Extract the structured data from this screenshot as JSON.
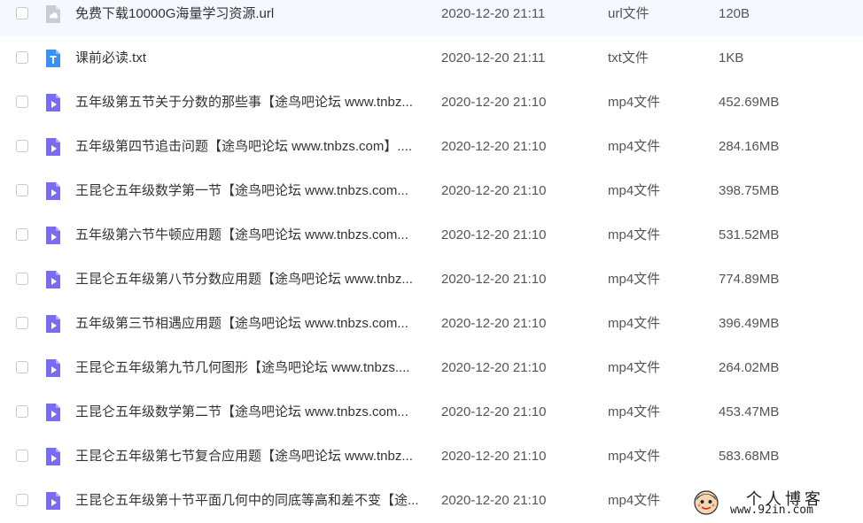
{
  "files": [
    {
      "icon": "link-file-icon",
      "name": "免费下载10000G海量学习资源.url",
      "date": "2020-12-20 21:11",
      "type": "url文件",
      "size": "120B"
    },
    {
      "icon": "text-file-icon",
      "name": "课前必读.txt",
      "date": "2020-12-20 21:11",
      "type": "txt文件",
      "size": "1KB"
    },
    {
      "icon": "video-file-icon",
      "name": "五年级第五节关于分数的那些事【途鸟吧论坛 www.tnbz...",
      "date": "2020-12-20 21:10",
      "type": "mp4文件",
      "size": "452.69MB"
    },
    {
      "icon": "video-file-icon",
      "name": "五年级第四节追击问题【途鸟吧论坛 www.tnbzs.com】....",
      "date": "2020-12-20 21:10",
      "type": "mp4文件",
      "size": "284.16MB"
    },
    {
      "icon": "video-file-icon",
      "name": "王昆仑五年级数学第一节【途鸟吧论坛 www.tnbzs.com...",
      "date": "2020-12-20 21:10",
      "type": "mp4文件",
      "size": "398.75MB"
    },
    {
      "icon": "video-file-icon",
      "name": "五年级第六节牛顿应用题【途鸟吧论坛 www.tnbzs.com...",
      "date": "2020-12-20 21:10",
      "type": "mp4文件",
      "size": "531.52MB"
    },
    {
      "icon": "video-file-icon",
      "name": "王昆仑五年级第八节分数应用题【途鸟吧论坛 www.tnbz...",
      "date": "2020-12-20 21:10",
      "type": "mp4文件",
      "size": "774.89MB"
    },
    {
      "icon": "video-file-icon",
      "name": "五年级第三节相遇应用题【途鸟吧论坛 www.tnbzs.com...",
      "date": "2020-12-20 21:10",
      "type": "mp4文件",
      "size": "396.49MB"
    },
    {
      "icon": "video-file-icon",
      "name": "王昆仑五年级第九节几何图形【途鸟吧论坛 www.tnbzs....",
      "date": "2020-12-20 21:10",
      "type": "mp4文件",
      "size": "264.02MB"
    },
    {
      "icon": "video-file-icon",
      "name": "王昆仑五年级数学第二节【途鸟吧论坛 www.tnbzs.com...",
      "date": "2020-12-20 21:10",
      "type": "mp4文件",
      "size": "453.47MB"
    },
    {
      "icon": "video-file-icon",
      "name": "王昆仑五年级第七节复合应用题【途鸟吧论坛 www.tnbz...",
      "date": "2020-12-20 21:10",
      "type": "mp4文件",
      "size": "583.68MB"
    },
    {
      "icon": "video-file-icon",
      "name": "王昆仑五年级第十节平面几何中的同底等高和差不变【途...",
      "date": "2020-12-20 21:10",
      "type": "mp4文件",
      "size": ""
    }
  ],
  "colors": {
    "video_icon": "#7a6cf0",
    "text_icon": "#3d8ef5",
    "link_icon": "#c9ccd3",
    "text_primary": "#333333",
    "text_secondary": "#555555"
  },
  "watermark": {
    "title": "个人博客",
    "url": "www.92in.com",
    "avatar_icon": "cartoon-avatar-icon"
  }
}
